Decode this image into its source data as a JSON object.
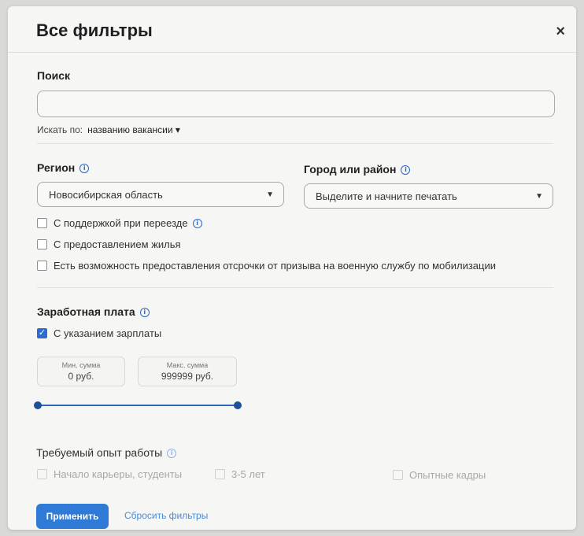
{
  "header": {
    "title": "Все фильтры",
    "close_glyph": "×"
  },
  "search": {
    "label": "Поиск",
    "value": "",
    "search_by_label": "Искать по:",
    "search_by_value": "названию вакансии ▾"
  },
  "region": {
    "label": "Регион",
    "value": "Новосибирская область",
    "city_label": "Город или район",
    "city_placeholder": "Выделите и начните печатать"
  },
  "options": [
    {
      "label": "С поддержкой при переезде",
      "checked": false
    },
    {
      "label": "С предоставлением жилья",
      "checked": false
    },
    {
      "label": "Есть возможность предоставления отсрочки от призыва на военную службу по мобилизации",
      "checked": false
    }
  ],
  "salary": {
    "label": "Заработная плата",
    "with_salary_label": "С указанием зарплаты",
    "with_salary_checked": true,
    "min_caption": "Мин. сумма",
    "min_value": "0 руб.",
    "max_caption": "Макс. сумма",
    "max_value": "999999 руб.",
    "slider_range": [
      0,
      999999
    ]
  },
  "experience": {
    "label": "Требуемый опыт работы",
    "options": [
      {
        "label": "Начало карьеры, студенты",
        "checked": false
      },
      {
        "label": "3-5 лет",
        "checked": false
      },
      {
        "label": "Опытные кадры",
        "checked": false
      }
    ]
  },
  "footer": {
    "apply_label": "Применить",
    "reset_label": "Сбросить фильтры"
  },
  "colors": {
    "accent": "#2f7ad6",
    "slider": "#2e66b8",
    "background": "#f6f6f4"
  },
  "icons": [
    "close-icon",
    "info-icon",
    "caret-down-icon",
    "checkbox-checked-icon"
  ]
}
